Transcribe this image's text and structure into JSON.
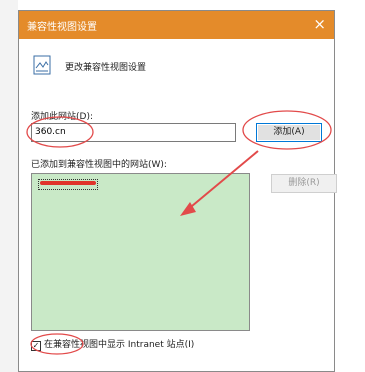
{
  "dialog": {
    "title": "兼容性视图设置",
    "close_glyph": "×",
    "header_text": "更改兼容性视图设置",
    "add_label": "添加此网站(D):",
    "site_input_value": "360.cn",
    "add_button": "添加(A)",
    "list_label": "已添加到兼容性视图中的网站(W):",
    "remove_button": "删除(R)",
    "checkbox_intranet": "在兼容性视图中显示 Intranet 站点(I)",
    "checkbox_intranet_checked": true
  }
}
